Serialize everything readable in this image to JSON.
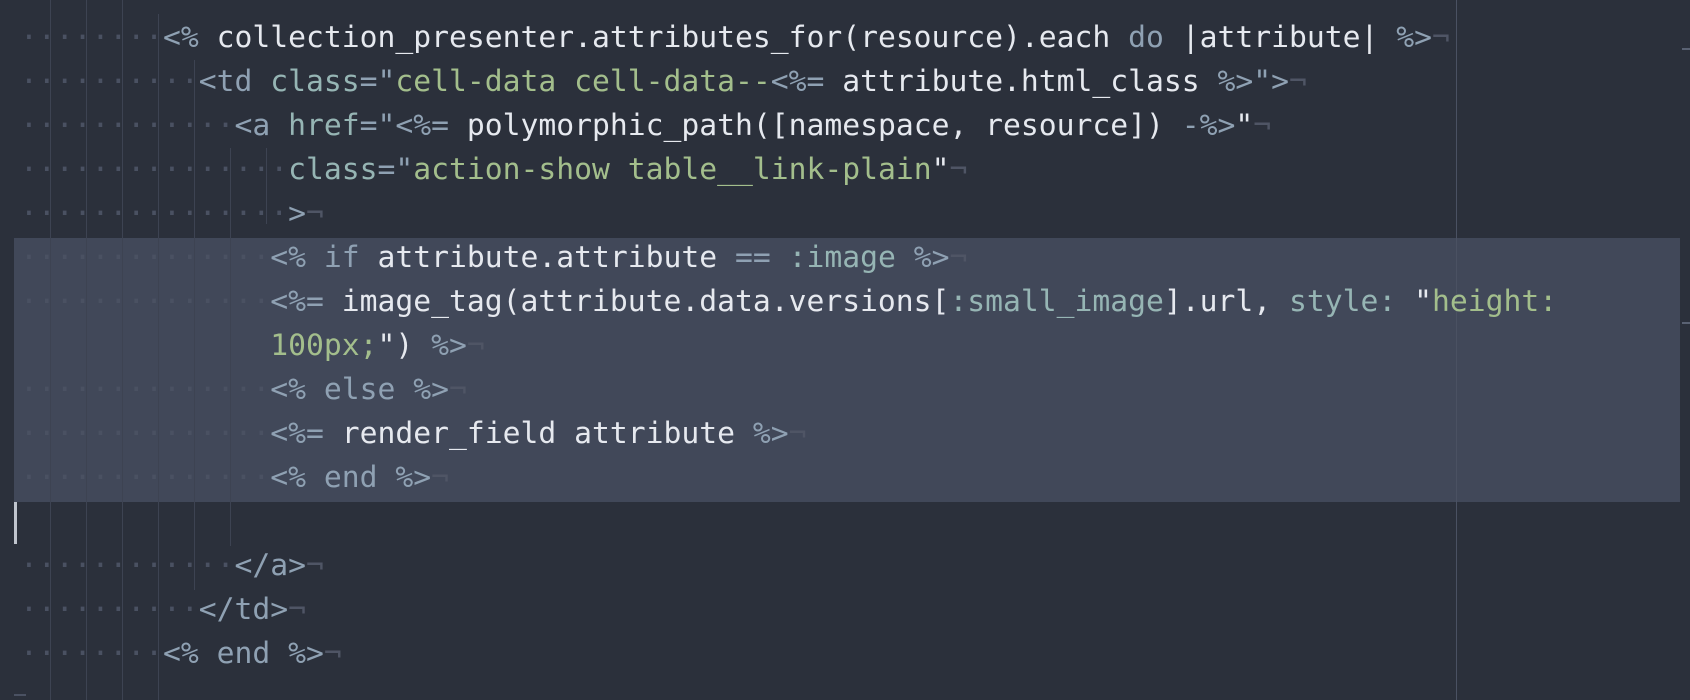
{
  "editor": {
    "eol_marker": "¬",
    "lines": [
      {
        "indent": 8,
        "parts": [
          {
            "t": "<% ",
            "c": "k"
          },
          {
            "t": "collection_presenter.attributes_for(resource).each ",
            "c": "t"
          },
          {
            "t": "do",
            "c": "k"
          },
          {
            "t": " |attribute| ",
            "c": "t"
          },
          {
            "t": "%>",
            "c": "k"
          }
        ]
      },
      {
        "indent": 10,
        "parts": [
          {
            "t": "<td ",
            "c": "k"
          },
          {
            "t": "class",
            "c": "a"
          },
          {
            "t": "=\"",
            "c": "k"
          },
          {
            "t": "cell-data cell-data--",
            "c": "s"
          },
          {
            "t": "<%=",
            "c": "k"
          },
          {
            "t": " attribute.html_class ",
            "c": "t"
          },
          {
            "t": "%>",
            "c": "k"
          },
          {
            "t": "\">",
            "c": "k"
          }
        ]
      },
      {
        "indent": 12,
        "parts": [
          {
            "t": "<a ",
            "c": "k"
          },
          {
            "t": "href",
            "c": "a"
          },
          {
            "t": "=\"",
            "c": "k"
          },
          {
            "t": "<%=",
            "c": "k"
          },
          {
            "t": " polymorphic_path([namespace, resource]) ",
            "c": "t"
          },
          {
            "t": "-%>",
            "c": "k"
          },
          {
            "t": "\"",
            "c": "t"
          }
        ]
      },
      {
        "indent": 15,
        "parts": [
          {
            "t": "class",
            "c": "a"
          },
          {
            "t": "=\"",
            "c": "k"
          },
          {
            "t": "action-show table__link-plain",
            "c": "s"
          },
          {
            "t": "\"",
            "c": "t"
          }
        ]
      },
      {
        "indent": 15,
        "parts": [
          {
            "t": ">",
            "c": "k"
          }
        ]
      },
      {
        "indent": 14,
        "parts": [
          {
            "t": "<% ",
            "c": "k"
          },
          {
            "t": "if",
            "c": "k"
          },
          {
            "t": " attribute.attribute ",
            "c": "t"
          },
          {
            "t": "==",
            "c": "k"
          },
          {
            "t": " ",
            "c": "t"
          },
          {
            "t": ":image",
            "c": "a"
          },
          {
            "t": " ",
            "c": "t"
          },
          {
            "t": "%>",
            "c": "k"
          }
        ]
      },
      {
        "indent": 14,
        "parts": [
          {
            "t": "<%=",
            "c": "k"
          },
          {
            "t": " image_tag(attribute.data.versions[",
            "c": "t"
          },
          {
            "t": ":small_image",
            "c": "a"
          },
          {
            "t": "].url, ",
            "c": "t"
          },
          {
            "t": "style:",
            "c": "a"
          },
          {
            "t": " \"",
            "c": "t"
          },
          {
            "t": "height:",
            "c": "s"
          }
        ],
        "noeol": true
      },
      {
        "indent": 14,
        "wrapped": true,
        "parts": [
          {
            "t": "100px;",
            "c": "s"
          },
          {
            "t": "\") ",
            "c": "t"
          },
          {
            "t": "%>",
            "c": "k"
          }
        ]
      },
      {
        "indent": 14,
        "parts": [
          {
            "t": "<% ",
            "c": "k"
          },
          {
            "t": "else",
            "c": "k"
          },
          {
            "t": " ",
            "c": "t"
          },
          {
            "t": "%>",
            "c": "k"
          }
        ]
      },
      {
        "indent": 14,
        "parts": [
          {
            "t": "<%=",
            "c": "k"
          },
          {
            "t": " render_field attribute ",
            "c": "t"
          },
          {
            "t": "%>",
            "c": "k"
          }
        ]
      },
      {
        "indent": 14,
        "parts": [
          {
            "t": "<% ",
            "c": "k"
          },
          {
            "t": "end",
            "c": "k"
          },
          {
            "t": " ",
            "c": "t"
          },
          {
            "t": "%>",
            "c": "k"
          }
        ]
      },
      {
        "indent": 0,
        "parts": []
      },
      {
        "indent": 12,
        "parts": [
          {
            "t": "</a>",
            "c": "k"
          }
        ]
      },
      {
        "indent": 10,
        "parts": [
          {
            "t": "</td>",
            "c": "k"
          }
        ]
      },
      {
        "indent": 8,
        "parts": [
          {
            "t": "<% ",
            "c": "k"
          },
          {
            "t": "end",
            "c": "k"
          },
          {
            "t": " ",
            "c": "t"
          },
          {
            "t": "%>",
            "c": "k"
          }
        ]
      }
    ]
  }
}
